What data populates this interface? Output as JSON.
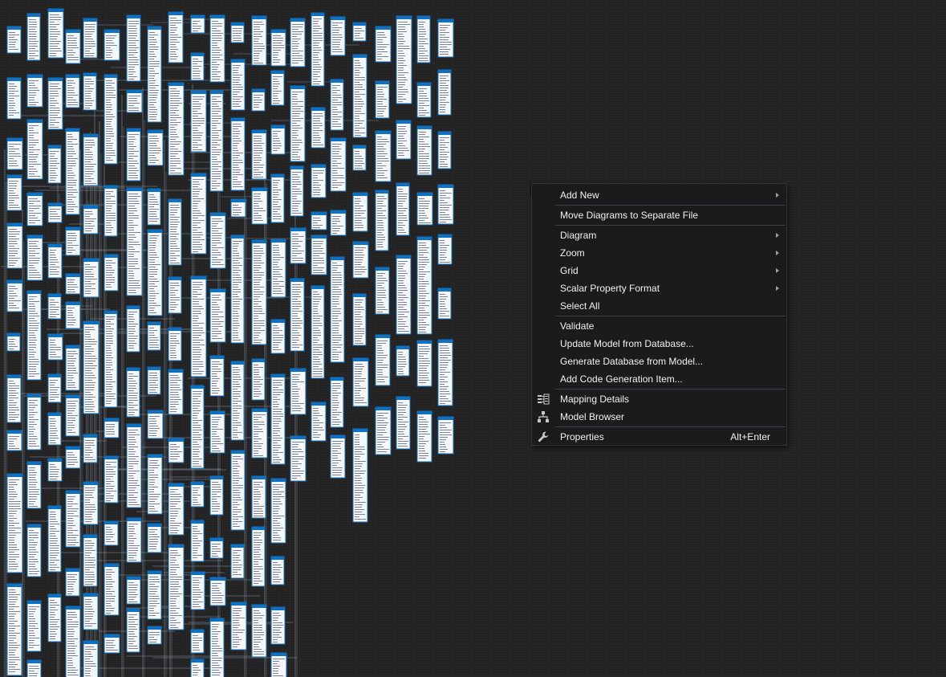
{
  "canvas": {
    "background": "#232323",
    "entity_header_color": "#0e70c0",
    "entity_body_color": "#f5f7fa",
    "connector_color": "#8a96a6"
  },
  "context_menu": {
    "items": [
      {
        "label": "Add New",
        "submenu": true
      },
      {
        "label": "Move Diagrams to Separate File"
      },
      {
        "label": "Diagram",
        "submenu": true
      },
      {
        "label": "Zoom",
        "submenu": true
      },
      {
        "label": "Grid",
        "submenu": true
      },
      {
        "label": "Scalar Property Format",
        "submenu": true
      },
      {
        "label": "Select All"
      },
      {
        "label": "Validate"
      },
      {
        "label": "Update Model from Database..."
      },
      {
        "label": "Generate Database from Model..."
      },
      {
        "label": "Add Code Generation Item..."
      },
      {
        "label": "Mapping Details",
        "icon": "mapping-details-icon"
      },
      {
        "label": "Model Browser",
        "icon": "model-browser-icon"
      },
      {
        "label": "Properties",
        "icon": "wrench-icon",
        "shortcut": "Alt+Enter"
      }
    ]
  }
}
